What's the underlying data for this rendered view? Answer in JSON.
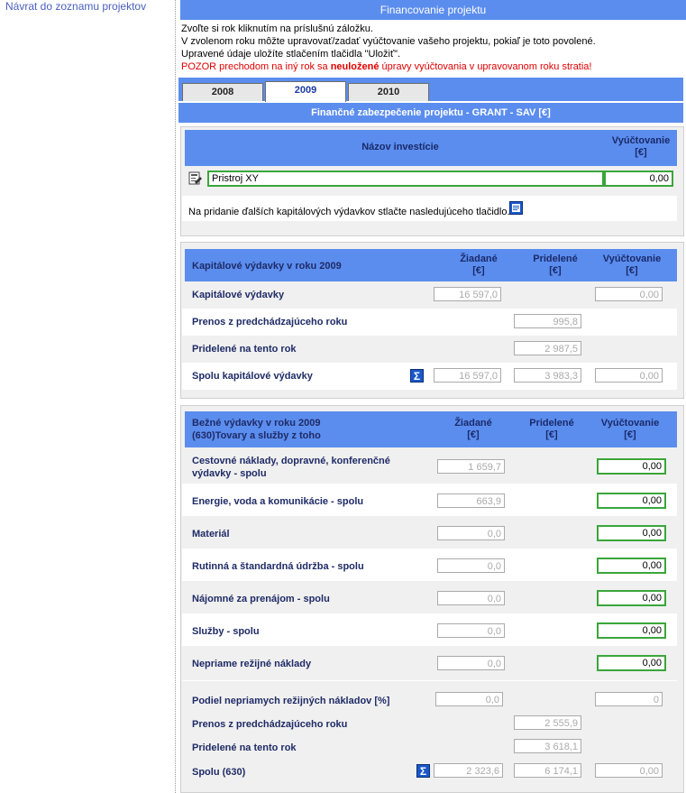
{
  "nav": {
    "back_link": "Návrat do zoznamu projektov"
  },
  "header": {
    "title": "Financovanie projektu"
  },
  "intro": {
    "line1": "Zvoľte si rok kliknutím na príslušnú záložku.",
    "line2": "V zvolenom roku môžte upravovať/zadať vyúčtovanie vašeho projektu, pokiaľ je toto povolené.",
    "line3": "Upravené údaje uložíte stlačením tlačidla \"Uložiť\".",
    "warn_prefix": "POZOR prechodom na iný rok sa ",
    "warn_bold": "neuložené",
    "warn_suffix": " úpravy vyúčtovania v upravovanom roku stratia!"
  },
  "tabs": [
    "2008",
    "2009",
    "2010"
  ],
  "active_tab": "2009",
  "subtitle": "Finančné zabezpečenie projektu - GRANT - SAV [€]",
  "investment": {
    "col_name": "Názov investície",
    "col_settle_1": "Vyúčtovanie",
    "col_settle_2": "[€]",
    "name_value": "Pristroj XY",
    "settle_value": "0,00",
    "add_text": "Na pridanie ďalších kapitálových výdavkov stlačte nasledujúceho tlačidlo."
  },
  "capital": {
    "title": "Kapitálové výdavky v roku 2009",
    "col_req_1": "Žiadané",
    "col_req_2": "[€]",
    "col_alloc_1": "Pridelené",
    "col_alloc_2": "[€]",
    "col_settle_1": "Vyúčtovanie",
    "col_settle_2": "[€]",
    "rows": [
      {
        "label": "Kapitálové výdavky",
        "req": "16 597,0",
        "settle": "0,00"
      },
      {
        "label": "Prenos z predchádzajúceho roku",
        "alloc": "995,8"
      },
      {
        "label": "Pridelené na tento rok",
        "alloc": "2 987,5"
      },
      {
        "label": "Spolu kapitálové výdavky",
        "req": "16 597,0",
        "alloc": "3 983,3",
        "settle": "0,00"
      }
    ]
  },
  "current": {
    "title_1": "Bežné výdavky v roku 2009",
    "title_2": "(630)Tovary a služby z toho",
    "col_req_1": "Žiadané",
    "col_req_2": "[€]",
    "col_alloc_1": "Pridelené",
    "col_alloc_2": "[€]",
    "col_settle_1": "Vyúčtovanie",
    "col_settle_2": "[€]",
    "rows": [
      {
        "label_1": "Cestovné náklady, dopravné, konferenčné",
        "label_2": "výdavky - spolu",
        "req": "1 659,7",
        "settle": "0,00"
      },
      {
        "label_1": "Energie, voda a komunikácie - spolu",
        "req": "663,9",
        "settle": "0,00"
      },
      {
        "label_1": "Materiál",
        "req": "0,0",
        "settle": "0,00"
      },
      {
        "label_1": "Rutinná a štandardná údržba - spolu",
        "req": "0,0",
        "settle": "0,00"
      },
      {
        "label_1": "Nájomné za prenájom - spolu",
        "req": "0,0",
        "settle": "0,00"
      },
      {
        "label_1": "Služby - spolu",
        "req": "0,0",
        "settle": "0,00"
      },
      {
        "label_1": "Nepriame režijné náklady",
        "req": "0,0",
        "settle": "0,00"
      }
    ],
    "share_label": "Podiel nepriamych režijných nákladov [%]",
    "share_req": "0,0",
    "share_settle": "0",
    "transfer_label": "Prenos z predchádzajúceho roku",
    "transfer_alloc": "2 555,9",
    "allocated_label": "Pridelené na tento rok",
    "allocated_alloc": "3 618,1",
    "total_label": "Spolu (630)",
    "total_req": "2 323,6",
    "total_alloc": "6 174,1",
    "total_settle": "0,00"
  }
}
